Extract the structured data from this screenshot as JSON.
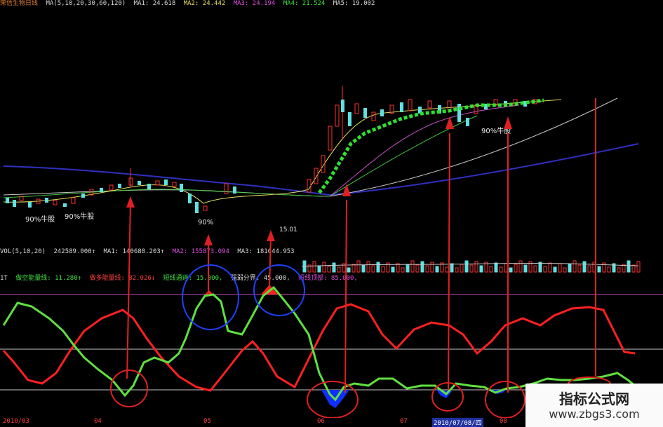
{
  "price_header": {
    "title": "荣信生物日线",
    "ma_params": "MA(5,10,20,30,60,120)",
    "ma1": "MA1: 24.618",
    "ma2": "MA2: 24.442",
    "ma3": "MA3: 24.194",
    "ma4": "MA4: 21.524",
    "ma5": "MA5: 19.002"
  },
  "price_labels": [
    "90%牛股",
    "90%牛股",
    "90%",
    "90%牛股"
  ],
  "price_note": "15.01",
  "vol_header": {
    "name": "VOL(5,10,20)",
    "vol": "242589.000↑",
    "ma1": "MA1: 140688.203↑",
    "ma2": "MA2: 155873.094",
    "ma3": "MA3: 181644.953"
  },
  "ind_header": {
    "name": "1T",
    "kong": "做空能量线: 11.280↑",
    "duo": "做多能量线: 82.026↓",
    "channel": "短线通道: 15.000,",
    "strong": "强弱分界: 45.000,",
    "short_top": "短线顶部: 85.000,"
  },
  "dates": [
    "2010/03",
    "04",
    "05",
    "06",
    "07",
    "2010/07/08/四",
    "08"
  ],
  "watermark": {
    "line1": "指标公式网",
    "line2": "www.zbgs3.com"
  },
  "colors": {
    "up": "#ff3030",
    "down": "#60e0e0",
    "green_line": "#40e040",
    "red_line": "#ff2020",
    "annotation": "#e02020",
    "circle": "#2040ff"
  }
}
